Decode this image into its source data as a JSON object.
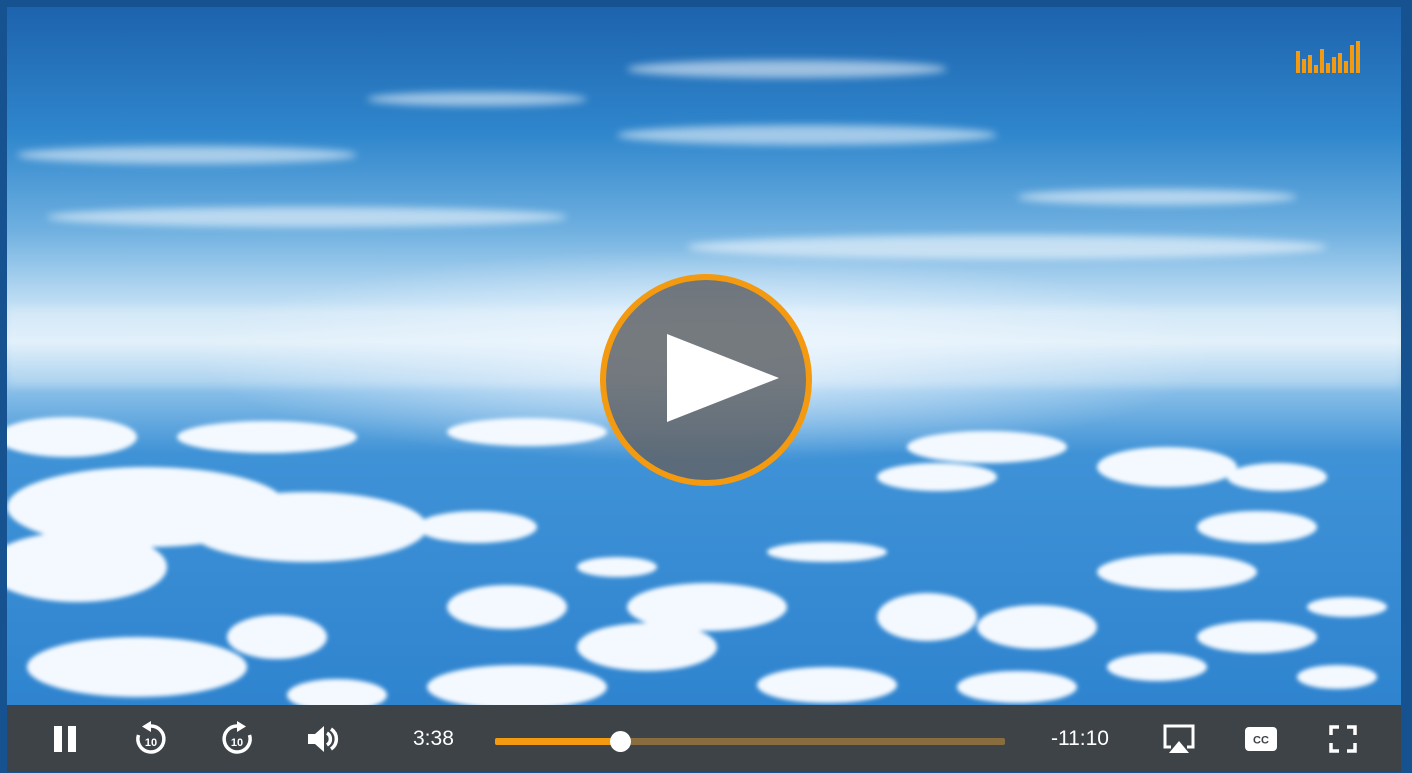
{
  "player": {
    "current_time": "3:38",
    "remaining_time": "-11:10",
    "progress_fraction": 0.245,
    "accent_color": "#f39a10",
    "controls": {
      "pause_icon": "pause-icon",
      "rewind_icon": "rewind-10-icon",
      "rewind_seconds": "10",
      "forward_icon": "forward-10-icon",
      "forward_seconds": "10",
      "volume_icon": "volume-icon",
      "airplay_icon": "airplay-icon",
      "captions_icon": "closed-captions-icon",
      "captions_label": "CC",
      "fullscreen_icon": "fullscreen-icon"
    },
    "overlay": {
      "play_icon": "play-icon",
      "signal_icon": "signal-bars-icon"
    }
  }
}
